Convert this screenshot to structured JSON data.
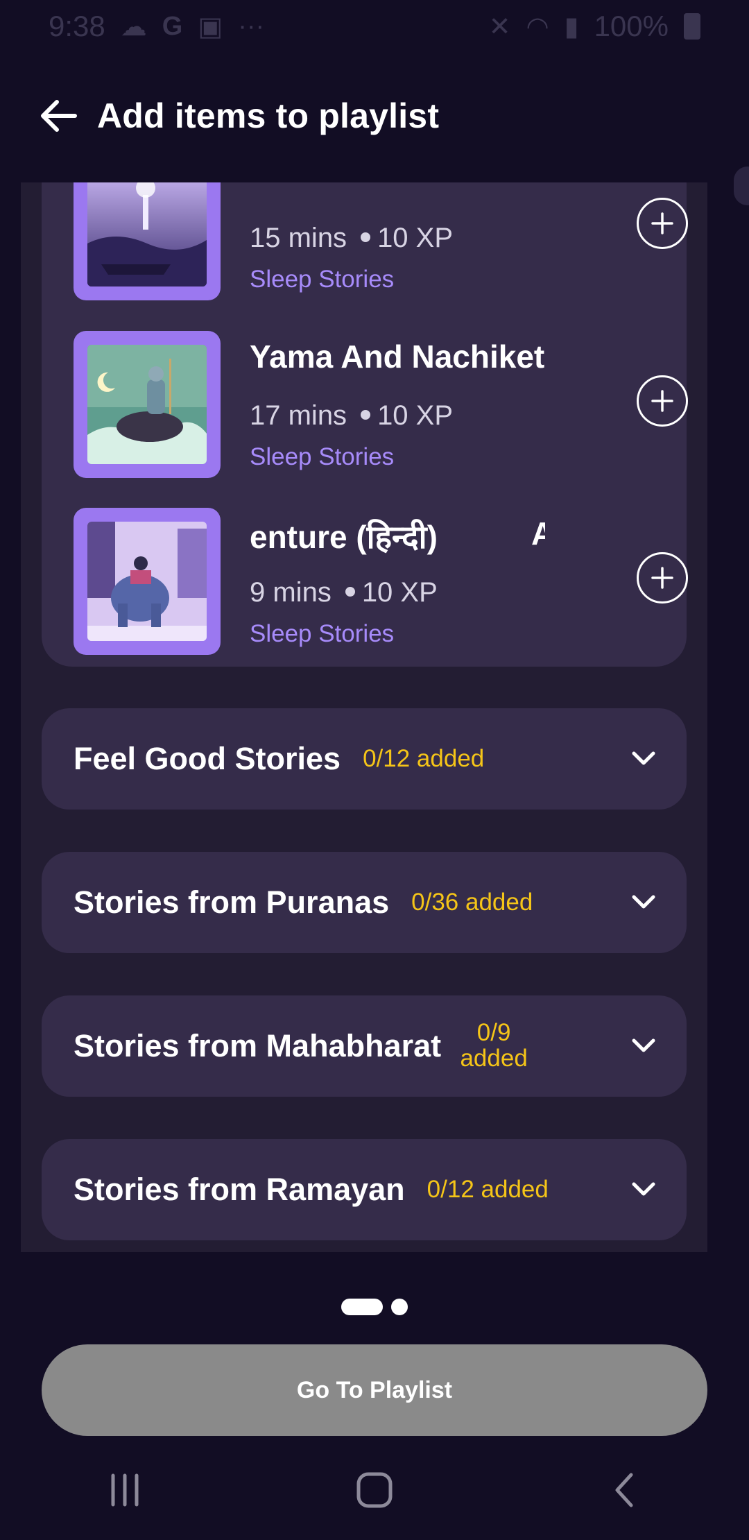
{
  "status_bar": {
    "time": "9:38",
    "battery": "100%",
    "left_icons": [
      "cloud-icon",
      "google-icon",
      "image-icon",
      "more-dots-icon"
    ],
    "right_icons": [
      "mute-icon",
      "wifi-icon",
      "signal-icon",
      "battery-icon"
    ]
  },
  "header": {
    "title": "Add items to playlist"
  },
  "items": [
    {
      "title": "",
      "duration": "15 mins",
      "xp": "10 XP",
      "category": "Sleep Stories"
    },
    {
      "title": "Yama And Nachiketa",
      "duration": "17 mins",
      "xp": "10 XP",
      "category": "Sleep Stories"
    },
    {
      "title": "enture (हिन्दी)",
      "title_tail": "A",
      "duration": "9 mins",
      "xp": "10 XP",
      "category": "Sleep Stories"
    }
  ],
  "sections": [
    {
      "title": "Feel Good Stories",
      "count": "0/12 added"
    },
    {
      "title": "Stories from Puranas",
      "count": "0/36 added"
    },
    {
      "title": "Stories from Mahabharat",
      "count": "0/9 added"
    },
    {
      "title": "Stories from Ramayan",
      "count": "0/12 added"
    }
  ],
  "pager": {
    "total": 2,
    "current": 1
  },
  "cta": {
    "label": "Go To Playlist"
  },
  "colors": {
    "background": "#120d24",
    "panel": "#231d33",
    "card": "#352c4a",
    "accent_purple": "#a78bfa",
    "thumb_border": "#9b78f0",
    "count_yellow": "#f5c518",
    "cta_disabled": "#8a8a8a"
  }
}
